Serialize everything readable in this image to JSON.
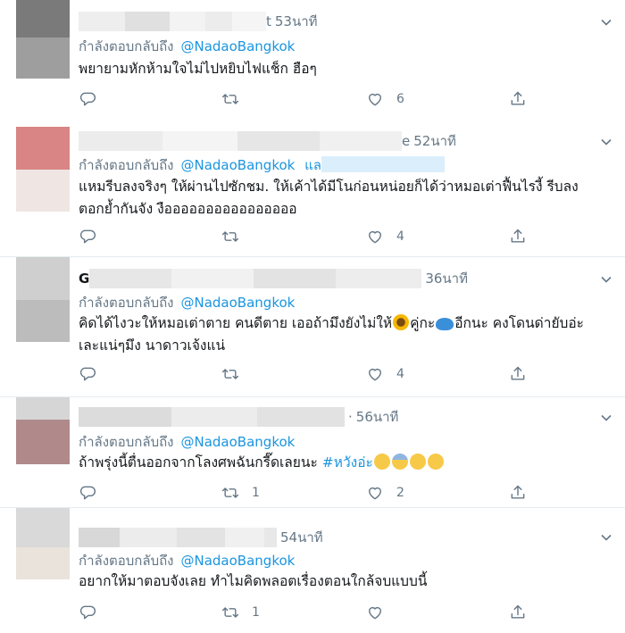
{
  "colors": {
    "link": "#1b95e0",
    "meta": "#657786",
    "text": "#14171a",
    "border": "#e6ecf0"
  },
  "icons": [
    "reply-icon",
    "retweet-icon",
    "like-icon",
    "share-icon",
    "chevron-down-icon"
  ],
  "tweets": [
    {
      "name_tail": "t",
      "time": "53นาที",
      "reply_label": "กำลังตอบกลับถึง",
      "reply_handle": "@NadaoBangkok",
      "reply_extra": "",
      "text": "พยายามหักห้ามใจไม่ไปหยิบไฟแช็ก ฮือๆ",
      "retweets": "",
      "likes": "6"
    },
    {
      "name_tail": "e",
      "time": "52นาที",
      "reply_label": "กำลังตอบกลับถึง",
      "reply_handle": "@NadaoBangkok",
      "reply_extra": "แล",
      "text": "แหมรีบลงจริงๆ ให้ผ่านไปซักชม. ให้เค้าได้มีโนก่อนหน่อยก็ได้ว่าหมอเต่าฟื้นไรงี้ รีบลงตอกย้ำกันจัง งืออออออออออออออออ",
      "retweets": "",
      "likes": "4"
    },
    {
      "name_tail": "",
      "time": "36นาที",
      "reply_label": "กำลังตอบกลับถึง",
      "reply_handle": "@NadaoBangkok",
      "reply_extra": "",
      "text_a": "คิดได้ไงวะให้หมอเต่าตาย คนดีตาย เออถ้ามึงยังไม่ให้",
      "text_b": "คู่กะ",
      "text_c": "อีกนะ คงโดนด่ายับอ่ะ เละแน่ๆมึง นาดาวเจ้งแน่",
      "retweets": "",
      "likes": "4"
    },
    {
      "name_tail": "",
      "time": "56นาที",
      "reply_label": "กำลังตอบกลับถึง",
      "reply_handle": "@NadaoBangkok",
      "reply_extra": "",
      "text": "ถ้าพรุ่งนี้ตื่นออกจากโลงศพฉันกรี๊ดเลยนะ",
      "hashtag": "#หวังอ่ะ",
      "retweets": "1",
      "likes": "2"
    },
    {
      "name_tail": "",
      "time": "54นาที",
      "reply_label": "กำลังตอบกลับถึง",
      "reply_handle": "@NadaoBangkok",
      "reply_extra": "",
      "text": "อยากให้มาตอบจังเลย ทำไมคิดพลอตเรื่องตอนใกล้จบแบบนี้",
      "retweets": "1",
      "likes": ""
    }
  ]
}
